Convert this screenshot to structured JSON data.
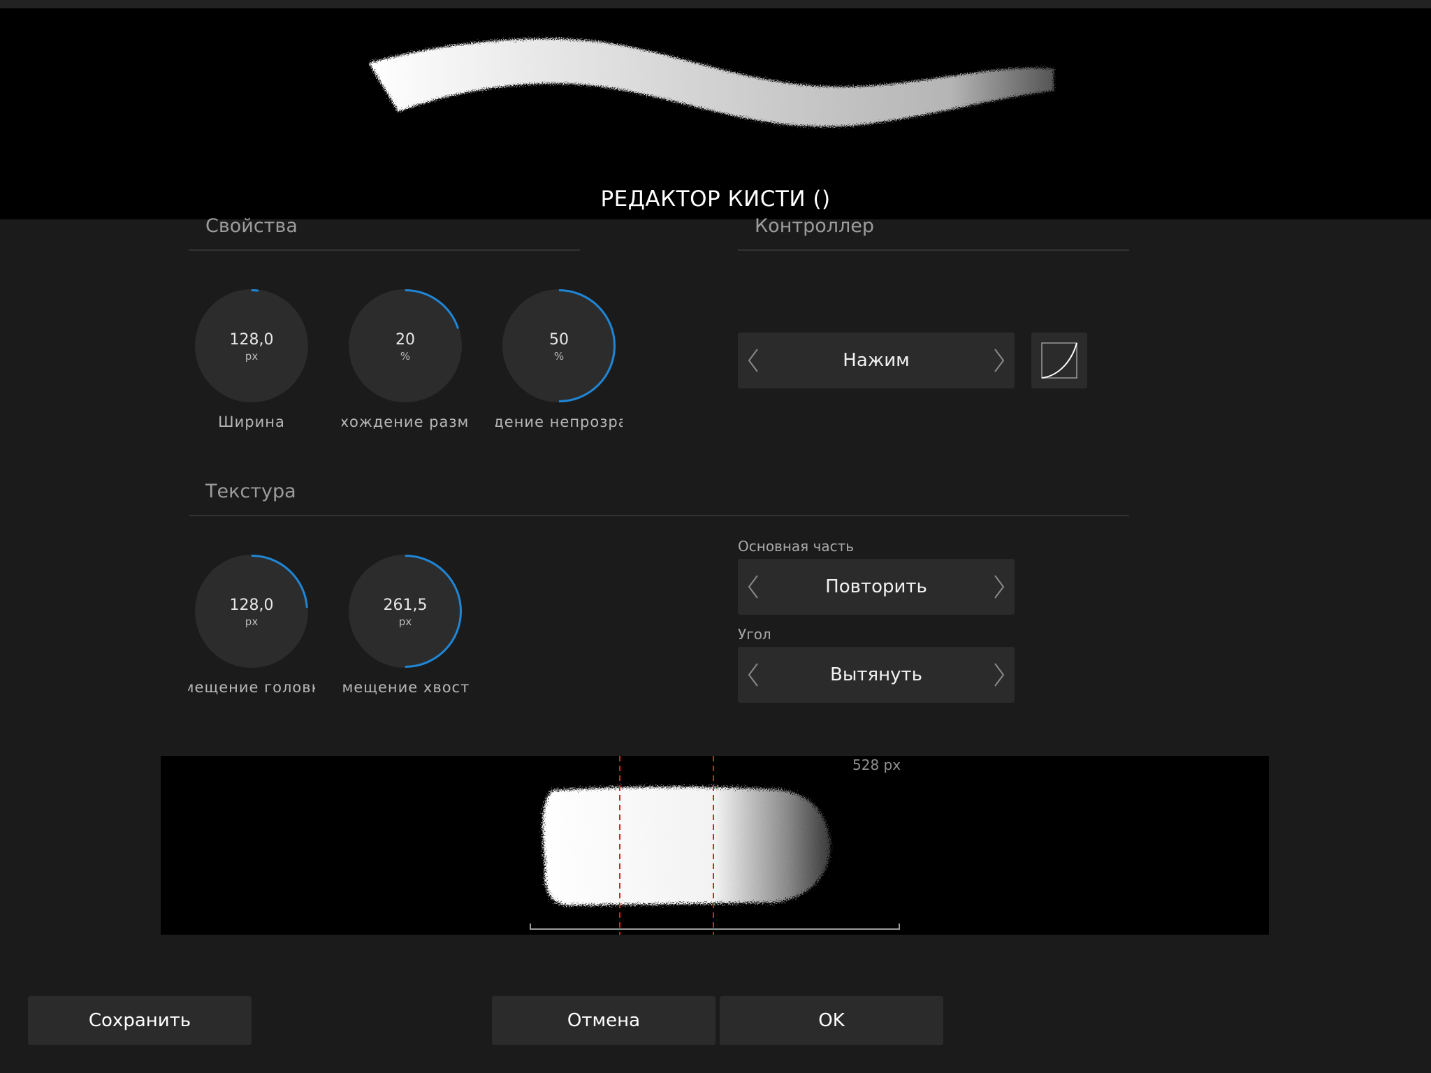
{
  "title": "РЕДАКТОР КИСТИ ()",
  "sections": {
    "properties": "Свойства",
    "controller": "Контроллер",
    "texture": "Текстура"
  },
  "properties_dials": [
    {
      "value": "128,0",
      "unit": "px",
      "label": "Ширина",
      "level": 0.02
    },
    {
      "value": "20",
      "unit": "%",
      "label": "Расхождение размера",
      "level": 0.2
    },
    {
      "value": "50",
      "unit": "%",
      "label": "Расхождение непрозрачности",
      "level": 0.5
    }
  ],
  "texture_dials": [
    {
      "value": "128,0",
      "unit": "px",
      "label": "Смещение головки",
      "level": 0.24
    },
    {
      "value": "261,5",
      "unit": "px",
      "label": "Смещение хвоста",
      "level": 0.5
    }
  ],
  "controller": {
    "selector": "Нажим",
    "curve_icon": "curve-icon"
  },
  "texture_options": {
    "main_part_label": "Основная часть",
    "main_part_value": "Повторить",
    "angle_label": "Угол",
    "angle_value": "Вытянуть"
  },
  "texture_preview": {
    "size_label": "528 px"
  },
  "buttons": {
    "save": "Сохранить",
    "cancel": "Отмена",
    "ok": "OK"
  },
  "colors": {
    "accent": "#1f86d6",
    "background": "#1b1b1b",
    "panel": "#2b2b2b",
    "guide": "#d8202a"
  }
}
